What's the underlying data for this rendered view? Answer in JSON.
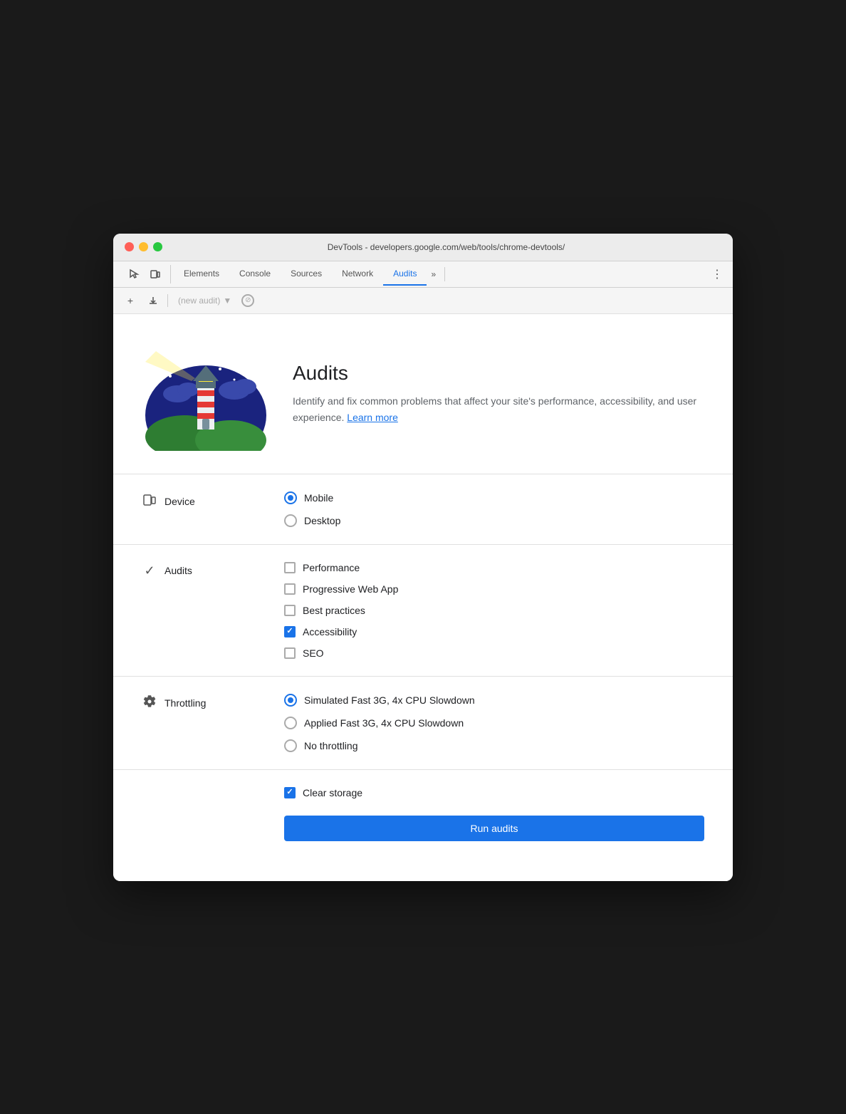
{
  "window": {
    "title": "DevTools - developers.google.com/web/tools/chrome-devtools/"
  },
  "tabs": {
    "items": [
      {
        "label": "Elements",
        "active": false
      },
      {
        "label": "Console",
        "active": false
      },
      {
        "label": "Sources",
        "active": false
      },
      {
        "label": "Network",
        "active": false
      },
      {
        "label": "Audits",
        "active": true
      }
    ],
    "more_label": "»",
    "kebab_label": "⋮"
  },
  "toolbar": {
    "new_audit_label": "(new audit)",
    "add_label": "+",
    "download_label": "⬇"
  },
  "hero": {
    "title": "Audits",
    "description": "Identify and fix common problems that affect your site's performance, accessibility, and user experience.",
    "learn_more": "Learn more"
  },
  "device_section": {
    "label": "Device",
    "icon": "device",
    "options": [
      {
        "label": "Mobile",
        "selected": true
      },
      {
        "label": "Desktop",
        "selected": false
      }
    ]
  },
  "audits_section": {
    "label": "Audits",
    "icon": "checkmark",
    "options": [
      {
        "label": "Performance",
        "checked": false
      },
      {
        "label": "Progressive Web App",
        "checked": false
      },
      {
        "label": "Best practices",
        "checked": false
      },
      {
        "label": "Accessibility",
        "checked": true
      },
      {
        "label": "SEO",
        "checked": false
      }
    ]
  },
  "throttling_section": {
    "label": "Throttling",
    "icon": "gear",
    "options": [
      {
        "label": "Simulated Fast 3G, 4x CPU Slowdown",
        "selected": true
      },
      {
        "label": "Applied Fast 3G, 4x CPU Slowdown",
        "selected": false
      },
      {
        "label": "No throttling",
        "selected": false
      }
    ]
  },
  "storage": {
    "label": "Clear storage",
    "checked": true
  },
  "run_button": {
    "label": "Run audits"
  }
}
